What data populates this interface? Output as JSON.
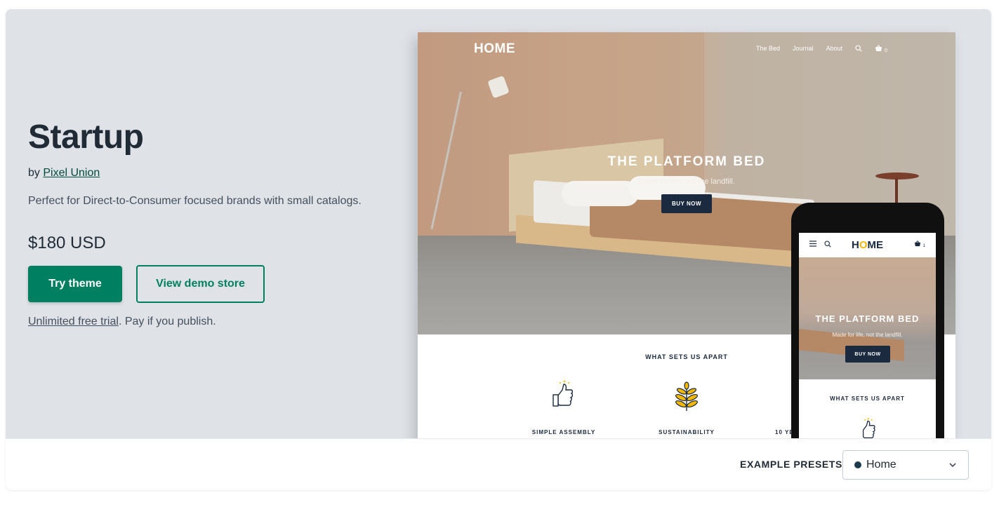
{
  "theme": {
    "title": "Startup",
    "by_prefix": "by ",
    "author": "Pixel Union",
    "description": "Perfect for Direct-to-Consumer focused brands with small catalogs.",
    "price": "$180 USD",
    "try_button": "Try theme",
    "demo_button": "View demo store",
    "trial_link": "Unlimited free trial",
    "trial_rest": ". Pay if you publish."
  },
  "preview": {
    "logo": "HOME",
    "nav": [
      "The Bed",
      "Journal",
      "About"
    ],
    "cart_count": "0",
    "hero_title": "THE PLATFORM BED",
    "hero_subtitle": "Made for life, not the landfill.",
    "hero_button": "BUY NOW",
    "section_title": "WHAT SETS US APART",
    "features": [
      "SIMPLE ASSEMBLY",
      "SUSTAINABILITY",
      "10 YE"
    ]
  },
  "mobile_preview": {
    "logo_start": "H",
    "logo_o": "O",
    "logo_end": "ME",
    "cart_count": "1",
    "hero_title": "THE PLATFORM BED",
    "hero_subtitle": "Made for life, not the landfill.",
    "hero_button": "BUY NOW",
    "section_title": "WHAT SETS US APART"
  },
  "presets": {
    "label": "EXAMPLE PRESETS",
    "selected": "Home",
    "selected_color": "#1b3a4b"
  },
  "colors": {
    "primary": "#008060",
    "background": "#dfe3e8",
    "preview_navy": "#1b2a3f",
    "accent_yellow": "#f5b800"
  },
  "icons": [
    "search-icon",
    "cart-icon",
    "thumbs-up-icon",
    "plant-icon",
    "menu-icon",
    "chevron-down-icon"
  ]
}
